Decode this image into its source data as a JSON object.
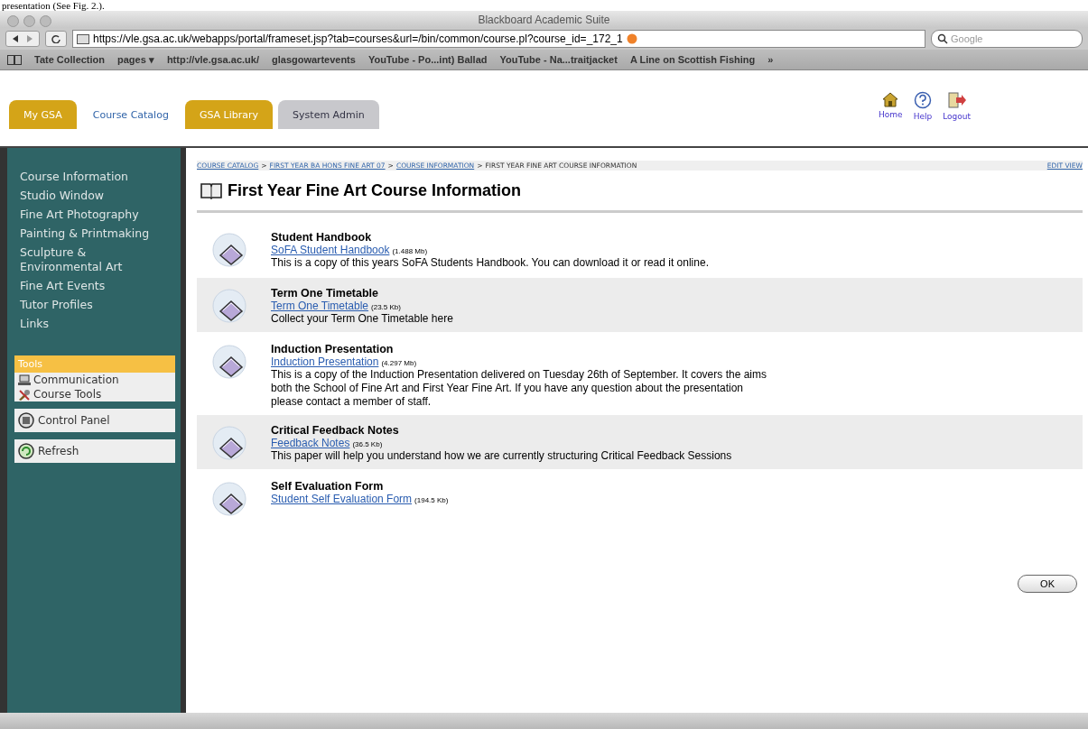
{
  "document_text": "presentation (See Fig. 2.).",
  "window": {
    "title": "Blackboard Academic Suite"
  },
  "address_bar": {
    "url": "https://vle.gsa.ac.uk/webapps/portal/frameset.jsp?tab=courses&url=/bin/common/course.pl?course_id=_172_1",
    "search_placeholder": "Google"
  },
  "bookmarks": [
    {
      "label": "Tate Collection"
    },
    {
      "label": "pages ▾"
    },
    {
      "label": "http://vle.gsa.ac.uk/"
    },
    {
      "label": "glasgowartevents"
    },
    {
      "label": "YouTube - Po...int) Ballad"
    },
    {
      "label": "YouTube - Na...traitjacket"
    },
    {
      "label": "A Line on Scottish Fishing"
    },
    {
      "label": "»"
    }
  ],
  "tabs": [
    {
      "label": "My GSA",
      "kind": "gold"
    },
    {
      "label": "Course Catalog",
      "kind": "plain"
    },
    {
      "label": "GSA Library",
      "kind": "gold"
    },
    {
      "label": "System Admin",
      "kind": "grey"
    }
  ],
  "header_links": [
    {
      "label": "Home",
      "kind": "home"
    },
    {
      "label": "Help",
      "kind": "help"
    },
    {
      "label": "Logout",
      "kind": "logout"
    }
  ],
  "sidebar": {
    "items": [
      "Course Information",
      "Studio Window",
      "Fine Art Photography",
      "Painting & Printmaking",
      "Sculpture & Environmental Art",
      "Fine Art Events",
      "Tutor Profiles",
      "Links"
    ],
    "tools": {
      "title": "Tools",
      "items": [
        {
          "label": "Communication",
          "kind": "communication"
        },
        {
          "label": "Course Tools",
          "kind": "tools"
        }
      ]
    },
    "buttons": [
      {
        "label": "Control Panel",
        "kind": "panel"
      },
      {
        "label": "Refresh",
        "kind": "refresh"
      }
    ]
  },
  "breadcrumb": {
    "separator": ">",
    "links": [
      "COURSE CATALOG",
      "FIRST YEAR BA HONS FINE ART 07",
      "COURSE INFORMATION"
    ],
    "current": "FIRST YEAR FINE ART COURSE INFORMATION",
    "edit_view": "EDIT VIEW"
  },
  "page_title": "First Year Fine Art Course Information",
  "items": [
    {
      "title": "Student Handbook",
      "link": "SoFA Student Handbook",
      "size": "(1.488 Mb)",
      "description": "This is a copy of this years SoFA Students Handbook. You can download it or read it online."
    },
    {
      "title": "Term One Timetable",
      "link": "Term One Timetable",
      "size": "(23.5 Kb)",
      "description": "Collect your Term One Timetable here"
    },
    {
      "title": "Induction Presentation",
      "link": "Induction Presentation",
      "size": "(4.297 Mb)",
      "description": "This is a copy of the Induction Presentation delivered on Tuesday 26th of September. It covers the aims both the School of Fine Art and First Year Fine Art. If you have any question about the presentation please contact a member of staff."
    },
    {
      "title": "Critical Feedback Notes",
      "link": "Feedback Notes",
      "size": "(36.5 Kb)",
      "description": "This paper will help you understand how we are currently structuring Critical Feedback Sessions"
    },
    {
      "title": "Self Evaluation Form",
      "link": "Student Self Evaluation Form",
      "size": "(194.5 Kb)"
    }
  ],
  "ok_button": "OK"
}
